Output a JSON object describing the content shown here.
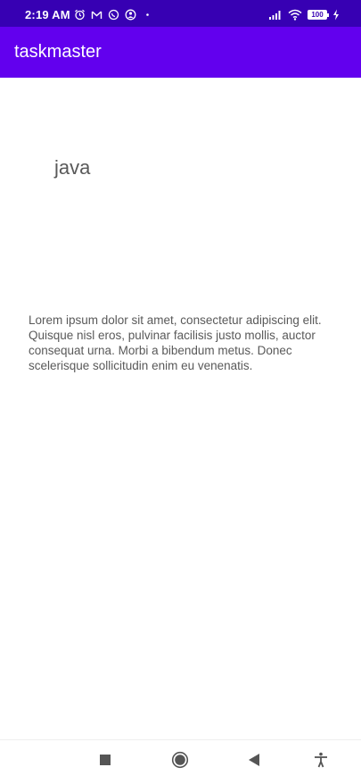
{
  "status_bar": {
    "time": "2:19 AM",
    "battery": "100",
    "left_icons": [
      "alarm-icon",
      "gmail-icon",
      "whatsapp-icon",
      "notification-icon",
      "dot-icon"
    ],
    "right_icons": [
      "signal-icon",
      "wifi-icon",
      "battery-icon",
      "charging-icon"
    ]
  },
  "app_bar": {
    "title": "taskmaster"
  },
  "task": {
    "title": "java",
    "body": "Lorem ipsum dolor sit amet, consectetur adipiscing elit. Quisque nisl eros, pulvinar facilisis justo mollis, auctor consequat urna. Morbi a bibendum metus. Donec scelerisque sollicitudin enim eu venenatis."
  },
  "nav_bar": {
    "buttons": [
      "recents-icon",
      "home-icon",
      "back-icon",
      "accessibility-icon"
    ]
  },
  "colors": {
    "status_bar": "#3700b3",
    "app_bar": "#6200ee",
    "text": "#595959"
  }
}
